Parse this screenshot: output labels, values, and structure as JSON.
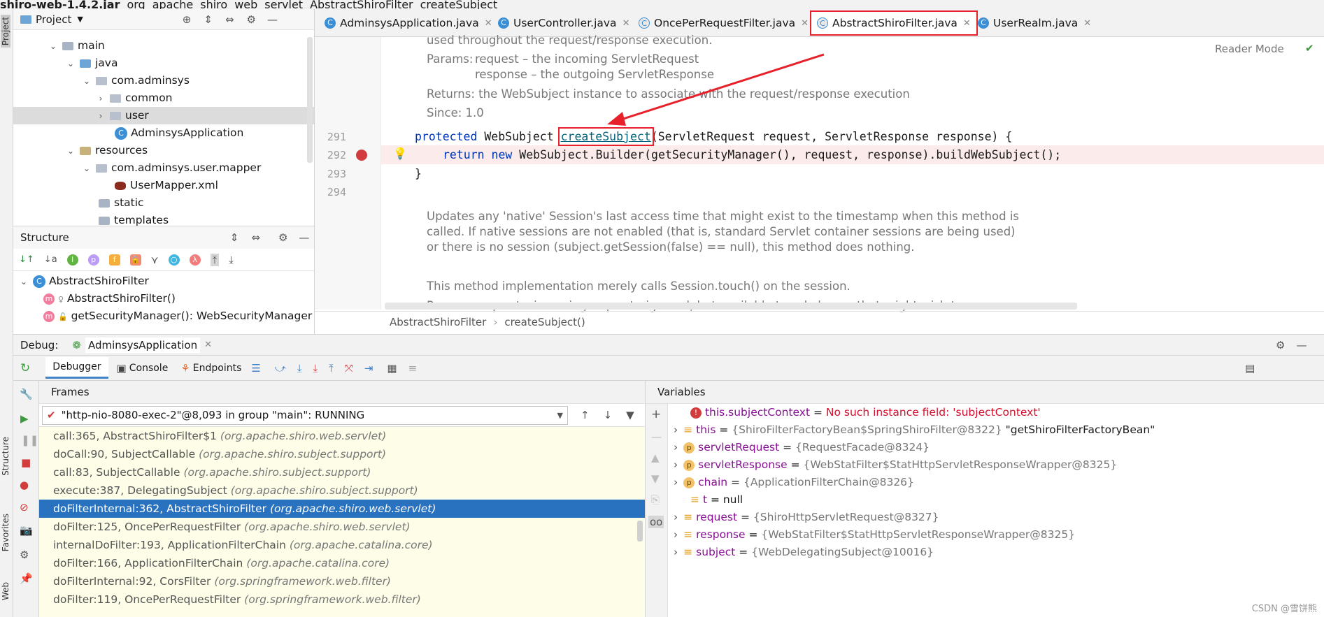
{
  "breadcrumb": [
    "shiro-web-1.4.2.jar",
    "org",
    "apache",
    "shiro",
    "web",
    "servlet",
    "AbstractShiroFilter",
    "createSubject"
  ],
  "left_strip": {
    "project": "Project",
    "structure": "Structure",
    "favorites": "Favorites",
    "web": "Web"
  },
  "project_panel": {
    "title": "Project",
    "tree": [
      {
        "label": "main",
        "kind": "folder",
        "expanded": true
      },
      {
        "label": "java",
        "kind": "folder-blue",
        "expanded": true
      },
      {
        "label": "com.adminsys",
        "kind": "package",
        "expanded": true
      },
      {
        "label": "common",
        "kind": "package",
        "expanded": false
      },
      {
        "label": "user",
        "kind": "package",
        "expanded": false,
        "selected": true
      },
      {
        "label": "AdminsysApplication",
        "kind": "class"
      },
      {
        "label": "resources",
        "kind": "folder",
        "expanded": true
      },
      {
        "label": "com.adminsys.user.mapper",
        "kind": "package",
        "expanded": true
      },
      {
        "label": "UserMapper.xml",
        "kind": "xml"
      },
      {
        "label": "static",
        "kind": "folder"
      },
      {
        "label": "templates",
        "kind": "folder"
      }
    ]
  },
  "structure_panel": {
    "title": "Structure",
    "items": [
      {
        "label": "AbstractShiroFilter",
        "kind": "class"
      },
      {
        "label": "AbstractShiroFilter()",
        "kind": "method"
      },
      {
        "label": "getSecurityManager(): WebSecurityManager",
        "kind": "method"
      }
    ]
  },
  "editor": {
    "tabs": [
      {
        "label": "AdminsysApplication.java",
        "active": false
      },
      {
        "label": "UserController.java",
        "active": false
      },
      {
        "label": "OncePerRequestFilter.java",
        "active": false
      },
      {
        "label": "AbstractShiroFilter.java",
        "active": true
      },
      {
        "label": "UserRealm.java",
        "active": false
      }
    ],
    "reader_mode": "Reader Mode",
    "doc_top": "used throughout the request/response execution.",
    "params_label": "Params:",
    "param1": "request – the incoming ServletRequest",
    "param2": "response – the outgoing ServletResponse",
    "returns": "Returns: the WebSubject instance to associate with the request/response execution",
    "since": "Since:    1.0",
    "lines": [
      "291",
      "292",
      "293",
      "294"
    ],
    "code_291_a": "protected",
    "code_291_b": " WebSubject ",
    "code_291_fn": "createSubject",
    "code_291_c": "(ServletRequest request, ServletResponse response) {",
    "code_292_kw1": "return",
    "code_292_kw2": " new",
    "code_292_rest": " WebSubject.Builder(getSecurityManager(), request, response).buildWebSubject();",
    "code_293": "}",
    "doc2_1": "Updates any 'native' Session's last access time that might exist to the timestamp when this method is",
    "doc2_2": "called. If native sessions are not enabled (that is, standard Servlet container sessions are being used)",
    "doc2_3": "or there is no session (subject.getSession(false) == null), this method does nothing.",
    "doc2_4": "This method implementation merely calls Session.touch() on the session.",
    "doc2_5": "Params: request – incoming request - ignored, but available to subclasses that might wish to",
    "crumb_class": "AbstractShiroFilter",
    "crumb_method": "createSubject()"
  },
  "debug": {
    "title": "Debug:",
    "session": "AdminsysApplication",
    "tabs": [
      "Debugger",
      "Console",
      "Endpoints"
    ],
    "frames_title": "Frames",
    "thread": "\"http-nio-8080-exec-2\"@8,093 in group \"main\": RUNNING",
    "frames": [
      {
        "loc": "call:365, AbstractShiroFilter$1",
        "pkg": "(org.apache.shiro.web.servlet)"
      },
      {
        "loc": "doCall:90, SubjectCallable",
        "pkg": "(org.apache.shiro.subject.support)"
      },
      {
        "loc": "call:83, SubjectCallable",
        "pkg": "(org.apache.shiro.subject.support)"
      },
      {
        "loc": "execute:387, DelegatingSubject",
        "pkg": "(org.apache.shiro.subject.support)"
      },
      {
        "loc": "doFilterInternal:362, AbstractShiroFilter",
        "pkg": "(org.apache.shiro.web.servlet)",
        "selected": true
      },
      {
        "loc": "doFilter:125, OncePerRequestFilter",
        "pkg": "(org.apache.shiro.web.servlet)"
      },
      {
        "loc": "internalDoFilter:193, ApplicationFilterChain",
        "pkg": "(org.apache.catalina.core)"
      },
      {
        "loc": "doFilter:166, ApplicationFilterChain",
        "pkg": "(org.apache.catalina.core)"
      },
      {
        "loc": "doFilterInternal:92, CorsFilter",
        "pkg": "(org.springframework.web.filter)"
      },
      {
        "loc": "doFilter:119, OncePerRequestFilter",
        "pkg": "(org.springframework.web.filter)"
      }
    ],
    "variables_title": "Variables",
    "variables": [
      {
        "name": "this.subjectContext",
        "eq": " = ",
        "value": "No such instance field: 'subjectContext'",
        "kind": "error"
      },
      {
        "name": "this",
        "eq": " = ",
        "value": "{ShiroFilterFactoryBean$SpringShiroFilter@8322}",
        "extra": " \"getShiroFilterFactoryBean\"",
        "kind": "field"
      },
      {
        "name": "servletRequest",
        "eq": " = ",
        "value": "{RequestFacade@8324}",
        "kind": "param"
      },
      {
        "name": "servletResponse",
        "eq": " = ",
        "value": "{WebStatFilter$StatHttpServletResponseWrapper@8325}",
        "kind": "param"
      },
      {
        "name": "chain",
        "eq": " = ",
        "value": "{ApplicationFilterChain@8326}",
        "kind": "param"
      },
      {
        "name": "t",
        "eq": " = ",
        "value": "null",
        "kind": "field"
      },
      {
        "name": "request",
        "eq": " = ",
        "value": "{ShiroHttpServletRequest@8327}",
        "kind": "field"
      },
      {
        "name": "response",
        "eq": " = ",
        "value": "{WebStatFilter$StatHttpServletResponseWrapper@8325}",
        "kind": "field"
      },
      {
        "name": "subject",
        "eq": " = ",
        "value": "{WebDelegatingSubject@10016}",
        "kind": "field"
      }
    ]
  },
  "watermark": "CSDN @雪饼熊",
  "colors": {
    "highlight_box": "#e8202a",
    "selection": "#2972c0",
    "keyword": "#0033b3",
    "error_line": "#fbeceb"
  }
}
